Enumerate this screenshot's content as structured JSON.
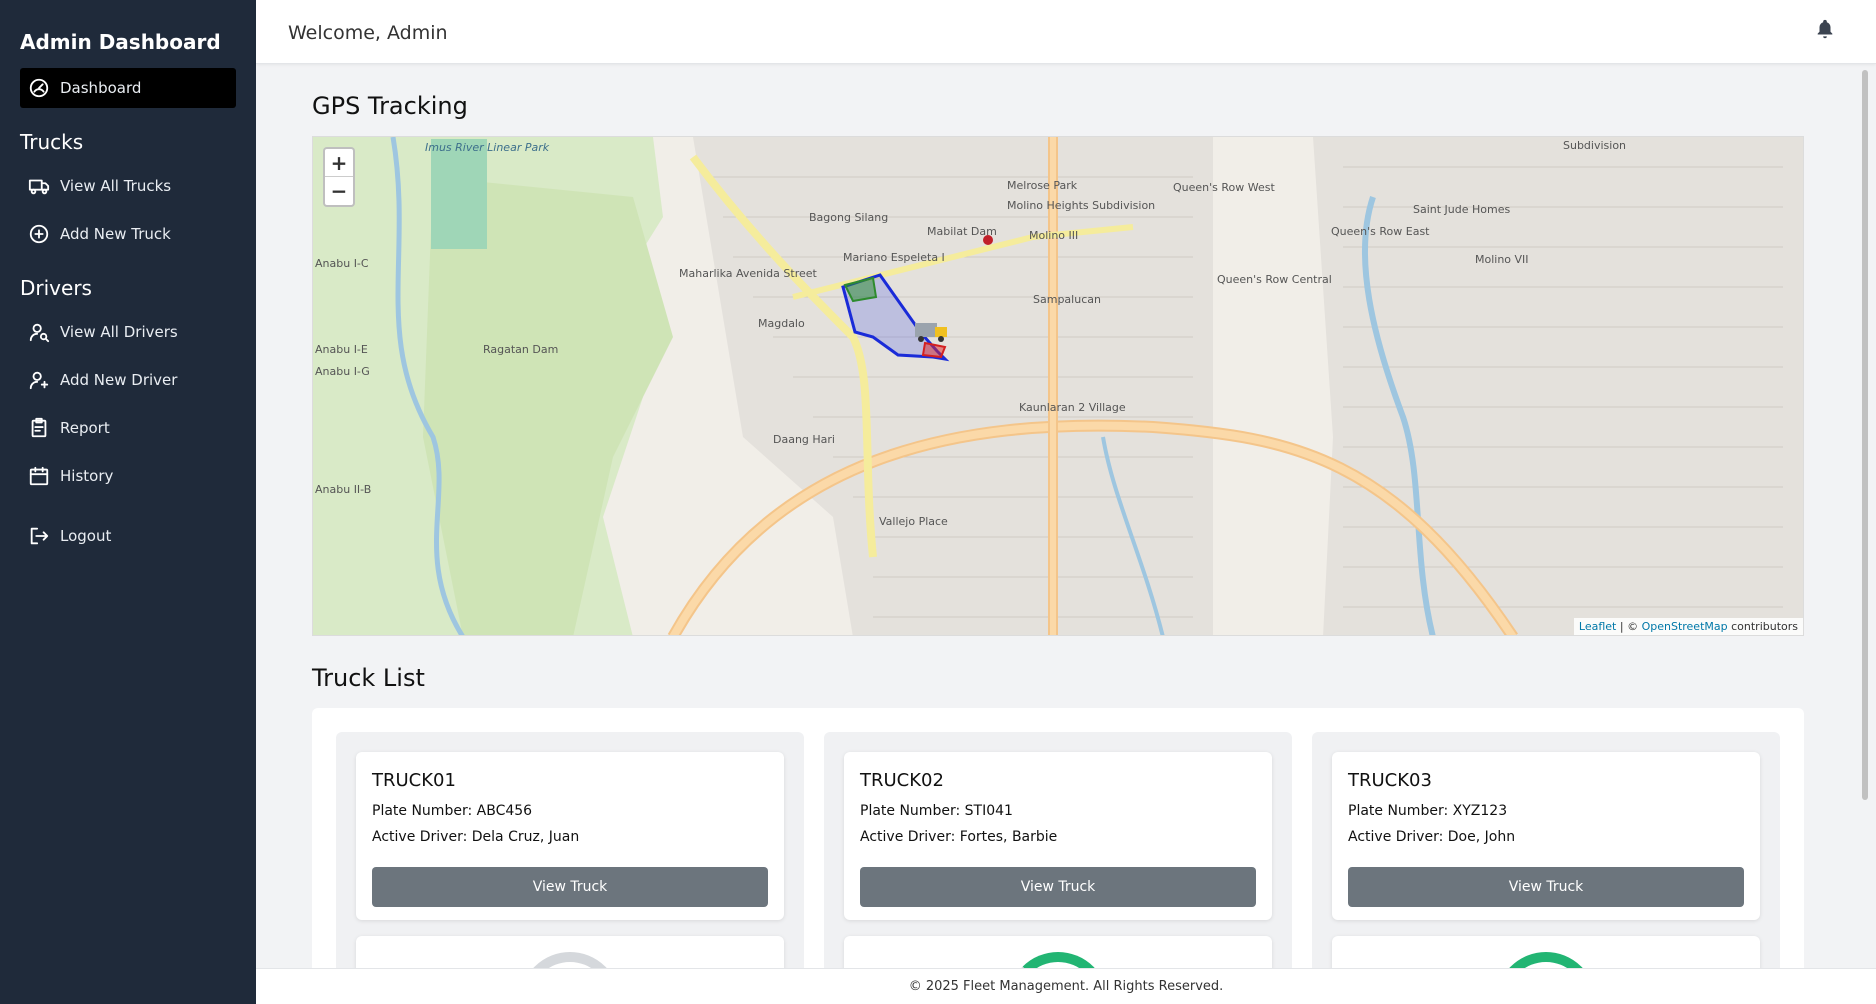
{
  "sidebar": {
    "brand": "Admin Dashboard",
    "dashboard": "Dashboard",
    "trucks_title": "Trucks",
    "view_all_trucks": "View All Trucks",
    "add_new_truck": "Add New Truck",
    "drivers_title": "Drivers",
    "view_all_drivers": "View All Drivers",
    "add_new_driver": "Add New Driver",
    "report": "Report",
    "history": "History",
    "logout": "Logout"
  },
  "header": {
    "welcome": "Welcome, Admin",
    "bell_icon": "bell-icon"
  },
  "gps": {
    "title": "GPS Tracking",
    "zoom_in": "+",
    "zoom_out": "−",
    "attribution_leaflet": "Leaflet",
    "attribution_sep": " | © ",
    "attribution_osm": "OpenStreetMap",
    "attribution_tail": " contributors",
    "labels": {
      "imus_park": "Imus River Linear Park",
      "bagong_silang": "Bagong Silang",
      "mariano": "Mariano Espeleta I",
      "magdalo": "Magdalo",
      "maharlika": "Maharlika Avenida Street",
      "ragatan": "Ragatan Dam",
      "anabu_1c": "Anabu I-C",
      "anabu_1e": "Anabu I-E",
      "anabu_1g": "Anabu I-G",
      "anabu_2b": "Anabu II-B",
      "melrose": "Melrose Park",
      "molino_heights": "Molino Heights Subdivision",
      "molino_iii": "Molino III",
      "mabilat_dam": "Mabilat Dam",
      "sampalucan": "Sampalucan",
      "kaunlaran": "Kaunlaran 2 Village",
      "queens_row_west": "Queen's Row West",
      "queens_row_east": "Queen's Row East",
      "queens_row_central": "Queen's Row Central",
      "saint_jude": "Saint Jude Homes",
      "molino_vii": "Molino VII",
      "daang_hari": "Daang Hari",
      "vallejo": "Vallejo Place",
      "subdivision": "Subdivision"
    }
  },
  "trucks": {
    "title": "Truck List",
    "plate_label": "Plate Number:",
    "driver_label": "Active Driver:",
    "button": "View Truck",
    "items": [
      {
        "name": "TRUCK01",
        "plate": "ABC456",
        "driver": "Dela Cruz, Juan"
      },
      {
        "name": "TRUCK02",
        "plate": "STI041",
        "driver": "Fortes, Barbie"
      },
      {
        "name": "TRUCK03",
        "plate": "XYZ123",
        "driver": "Doe, John"
      }
    ]
  },
  "footer": {
    "text": "© 2025 Fleet Management. All Rights Reserved."
  },
  "colors": {
    "sidebar_bg": "#1f2a3a",
    "button_gray": "#6c757d",
    "gauge_green": "#22b573",
    "route_blue": "#1a2bd8"
  }
}
